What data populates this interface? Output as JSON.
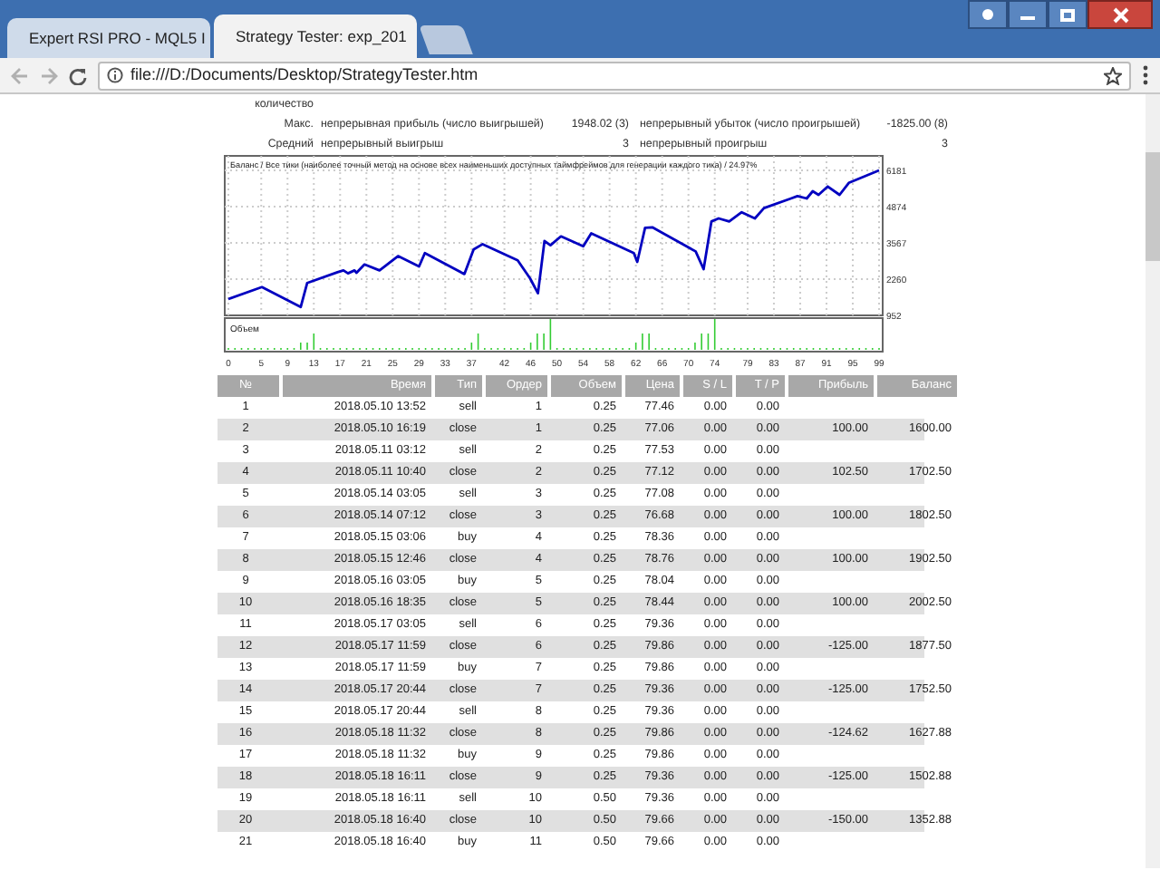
{
  "browser": {
    "tabs": [
      {
        "title": "Expert RSI PRO - MQL5 I",
        "selected": false
      },
      {
        "title": "Strategy Tester: exp_201",
        "selected": true
      }
    ],
    "url": "file:///D:/Documents/Desktop/StrategyTester.htm"
  },
  "stats_rows": [
    {
      "label": "количество"
    },
    {
      "label": "Макс.",
      "item_1": "непрерывная прибыль (число выигрышей)",
      "value_1": "1948.02 (3)",
      "item_2": "непрерывный убыток (число проигрышей)",
      "value_2": "-1825.00 (8)"
    },
    {
      "label": "Средний",
      "item_1": "непрерывный выигрыш",
      "value_1": "3",
      "item_2": "непрерывный проигрыш",
      "value_2": "3"
    }
  ],
  "chart": {
    "volume_label": "Объем",
    "chart_data": {
      "type": "line",
      "title": "Баланс / Все тики (наиболее точный метод на основе всех наименьших доступных таймфреймов для генерации каждого тика) / 24.97%",
      "x": [
        0,
        5.1,
        11,
        12,
        16.6,
        17.5,
        18.2,
        19.2,
        19.5,
        20.7,
        23,
        25.8,
        29,
        29.9,
        35.9,
        37.3,
        38.7,
        44,
        45.9,
        47.1,
        48.1,
        49,
        50.6,
        54,
        55.2,
        61.7,
        62.2,
        63.4,
        64.5,
        71.1,
        72.3,
        73.5,
        74.6,
        76.2,
        78.1,
        80.1,
        81.5,
        85.6,
        86.6,
        88,
        88.9,
        89.8,
        91.2,
        93,
        94.4,
        99
      ],
      "series": [
        {
          "color": "#0000c0",
          "values": [
            1540,
            1970,
            1250,
            2120,
            2510,
            2570,
            2470,
            2570,
            2490,
            2790,
            2570,
            3090,
            2720,
            3200,
            2440,
            3330,
            3520,
            2940,
            2290,
            1750,
            3630,
            3480,
            3800,
            3440,
            3910,
            3200,
            2880,
            4110,
            4130,
            3260,
            2620,
            4340,
            4450,
            4340,
            4670,
            4450,
            4820,
            5170,
            5250,
            5170,
            5430,
            5300,
            5600,
            5300,
            5730,
            6180
          ]
        }
      ],
      "grid": true,
      "xlim": [
        0,
        99
      ],
      "ylim": [
        952,
        6181
      ],
      "xticks": [
        0,
        5,
        9,
        13,
        17,
        21,
        25,
        29,
        33,
        37,
        42,
        46,
        50,
        54,
        58,
        62,
        66,
        70,
        74,
        79,
        83,
        87,
        91,
        95,
        99
      ],
      "yticks": [
        952,
        2260,
        3567,
        4874,
        6181
      ]
    }
  },
  "table": {
    "columns": [
      "№",
      "Время",
      "Тип",
      "Ордер",
      "Объем",
      "Цена",
      "S / L",
      "T / P",
      "Прибыль",
      "Баланс"
    ],
    "rows": [
      [
        "1",
        "2018.05.10 13:52",
        "sell",
        "1",
        "0.25",
        "77.46",
        "0.00",
        "0.00"
      ],
      [
        "2",
        "2018.05.10 16:19",
        "close",
        "1",
        "0.25",
        "77.06",
        "0.00",
        "0.00",
        "100.00",
        "1600.00"
      ],
      [
        "3",
        "2018.05.11 03:12",
        "sell",
        "2",
        "0.25",
        "77.53",
        "0.00",
        "0.00"
      ],
      [
        "4",
        "2018.05.11 10:40",
        "close",
        "2",
        "0.25",
        "77.12",
        "0.00",
        "0.00",
        "102.50",
        "1702.50"
      ],
      [
        "5",
        "2018.05.14 03:05",
        "sell",
        "3",
        "0.25",
        "77.08",
        "0.00",
        "0.00"
      ],
      [
        "6",
        "2018.05.14 07:12",
        "close",
        "3",
        "0.25",
        "76.68",
        "0.00",
        "0.00",
        "100.00",
        "1802.50"
      ],
      [
        "7",
        "2018.05.15 03:06",
        "buy",
        "4",
        "0.25",
        "78.36",
        "0.00",
        "0.00"
      ],
      [
        "8",
        "2018.05.15 12:46",
        "close",
        "4",
        "0.25",
        "78.76",
        "0.00",
        "0.00",
        "100.00",
        "1902.50"
      ],
      [
        "9",
        "2018.05.16 03:05",
        "buy",
        "5",
        "0.25",
        "78.04",
        "0.00",
        "0.00"
      ],
      [
        "10",
        "2018.05.16 18:35",
        "close",
        "5",
        "0.25",
        "78.44",
        "0.00",
        "0.00",
        "100.00",
        "2002.50"
      ],
      [
        "11",
        "2018.05.17 03:05",
        "sell",
        "6",
        "0.25",
        "79.36",
        "0.00",
        "0.00"
      ],
      [
        "12",
        "2018.05.17 11:59",
        "close",
        "6",
        "0.25",
        "79.86",
        "0.00",
        "0.00",
        "-125.00",
        "1877.50"
      ],
      [
        "13",
        "2018.05.17 11:59",
        "buy",
        "7",
        "0.25",
        "79.86",
        "0.00",
        "0.00"
      ],
      [
        "14",
        "2018.05.17 20:44",
        "close",
        "7",
        "0.25",
        "79.36",
        "0.00",
        "0.00",
        "-125.00",
        "1752.50"
      ],
      [
        "15",
        "2018.05.17 20:44",
        "sell",
        "8",
        "0.25",
        "79.36",
        "0.00",
        "0.00"
      ],
      [
        "16",
        "2018.05.18 11:32",
        "close",
        "8",
        "0.25",
        "79.86",
        "0.00",
        "0.00",
        "-124.62",
        "1627.88"
      ],
      [
        "17",
        "2018.05.18 11:32",
        "buy",
        "9",
        "0.25",
        "79.86",
        "0.00",
        "0.00"
      ],
      [
        "18",
        "2018.05.18 16:11",
        "close",
        "9",
        "0.25",
        "79.36",
        "0.00",
        "0.00",
        "-125.00",
        "1502.88"
      ],
      [
        "19",
        "2018.05.18 16:11",
        "sell",
        "10",
        "0.50",
        "79.36",
        "0.00",
        "0.00"
      ],
      [
        "20",
        "2018.05.18 16:40",
        "close",
        "10",
        "0.50",
        "79.66",
        "0.00",
        "0.00",
        "-150.00",
        "1352.88"
      ],
      [
        "21",
        "2018.05.18 16:40",
        "buy",
        "11",
        "0.50",
        "79.66",
        "0.00",
        "0.00"
      ]
    ]
  }
}
